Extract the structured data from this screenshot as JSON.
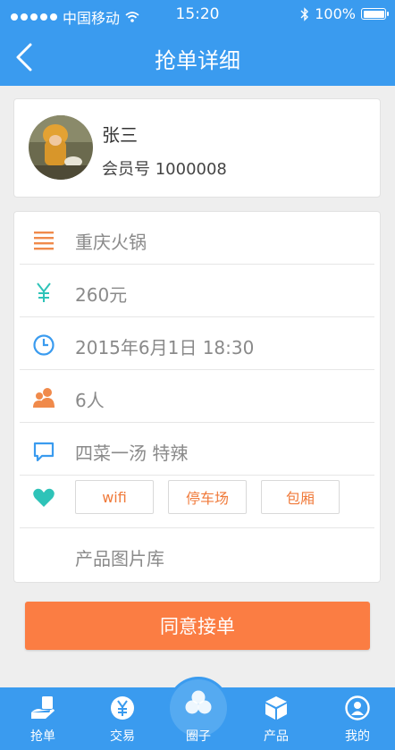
{
  "status_bar": {
    "carrier": "中国移动",
    "time": "15:20",
    "battery": "100%"
  },
  "header": {
    "title": "抢单详细"
  },
  "profile": {
    "name": "张三",
    "member_id": "会员号 1000008"
  },
  "details": {
    "restaurant": "重庆火锅",
    "price": "260元",
    "datetime": "2015年6月1日 18:30",
    "people": "6人",
    "note": "四菜一汤 特辣",
    "tags": [
      "wifi",
      "停车场",
      "包厢"
    ],
    "gallery": "产品图片库"
  },
  "accept_button": "同意接单",
  "tabbar": {
    "items": [
      "抢单",
      "交易",
      "圈子",
      "产品",
      "我的"
    ]
  },
  "colors": {
    "primary": "#3a9bef",
    "accent": "#fb7d43",
    "teal": "#2ec3b8"
  }
}
